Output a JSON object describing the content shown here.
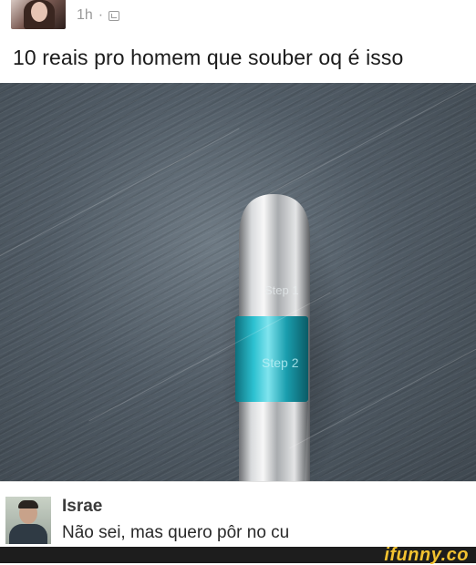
{
  "post": {
    "time": "1h",
    "separator": "·",
    "caption": "10 reais pro homem que souber oq é isso"
  },
  "photo": {
    "label_step1": "Step 1",
    "label_step2": "Step 2"
  },
  "comment": {
    "author": "Israe",
    "text": "Não sei, mas quero pôr no cu"
  },
  "watermark": "ifunny.co",
  "colors": {
    "accent_teal": "#1ea3b3",
    "watermark": "#f2c230",
    "footer": "#1d1d1d"
  }
}
